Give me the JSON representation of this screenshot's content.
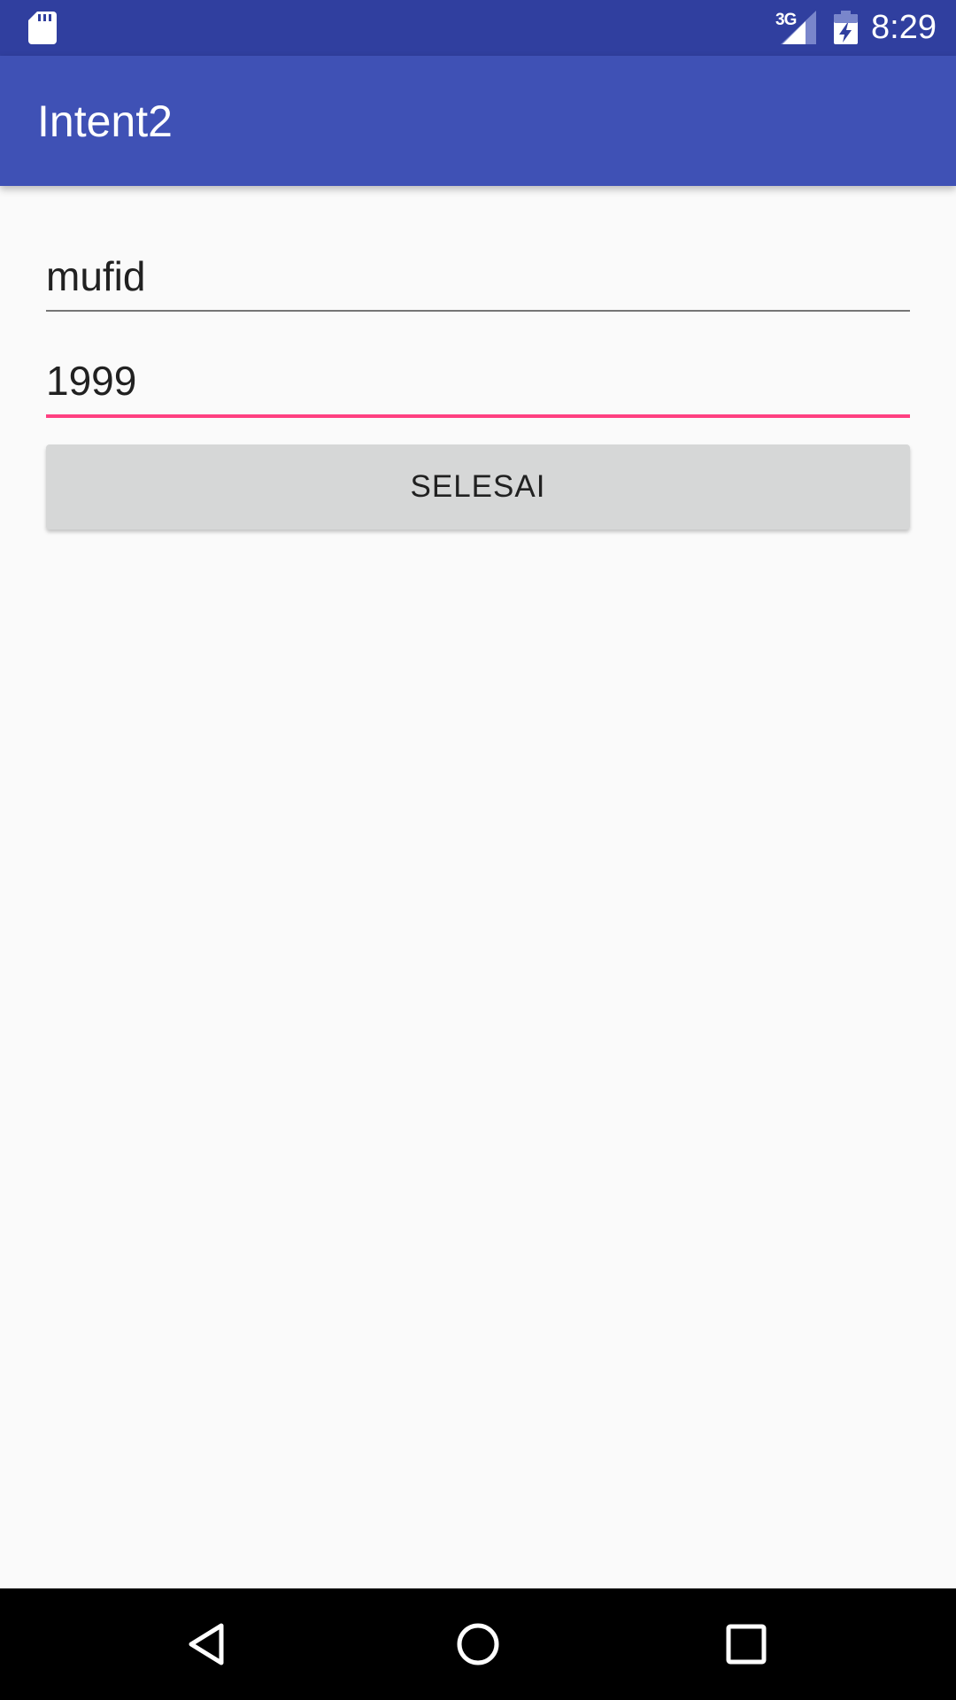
{
  "status_bar": {
    "network": "3G",
    "time": "8:29",
    "icons": [
      "sd-card-icon",
      "signal-icon",
      "battery-charging-icon"
    ]
  },
  "app_bar": {
    "title": "Intent2"
  },
  "form": {
    "name_value": "mufid",
    "year_value": "1999",
    "done_label": "SELESAI"
  },
  "nav_bar": {
    "icons": [
      "back-icon",
      "home-icon",
      "recent-apps-icon"
    ]
  },
  "colors": {
    "status_bar": "#303f9f",
    "primary": "#3f51b5",
    "accent": "#ff4081",
    "background": "#fafafa",
    "button": "#d6d7d7"
  }
}
